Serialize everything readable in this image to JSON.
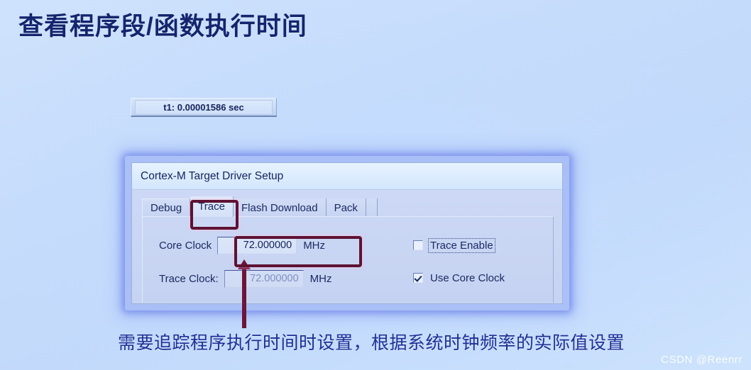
{
  "slide": {
    "heading": "查看程序段/函数执行时间",
    "caption": "需要追踪程序执行时间时设置，根据系统时钟频率的实际值设置",
    "watermark": "CSDN @Reenrr",
    "background_color": "#c6dcfb",
    "heading_color": "#14256e",
    "caption_color": "#1e2f96",
    "highlight_color": "#5e1233",
    "arrow_color": "#6b1538"
  },
  "tooltip": {
    "text": "t1: 0.00001586 sec"
  },
  "dialog": {
    "title": "Cortex-M Target Driver Setup",
    "tabs": [
      {
        "label": "Debug",
        "active": false
      },
      {
        "label": "Trace",
        "active": true
      },
      {
        "label": "Flash Download",
        "active": false
      },
      {
        "label": "Pack",
        "active": false
      }
    ],
    "fields": [
      {
        "label": "Core Clock",
        "value": "72.000000",
        "unit": "MHz",
        "disabled": false
      },
      {
        "label": "Trace Clock:",
        "value": "72.000000",
        "unit": "MHz",
        "disabled": true
      }
    ],
    "checkboxes": [
      {
        "label": "Trace Enable",
        "checked": false,
        "focused": true
      },
      {
        "label": "Use Core Clock",
        "checked": true,
        "focused": false
      }
    ]
  }
}
